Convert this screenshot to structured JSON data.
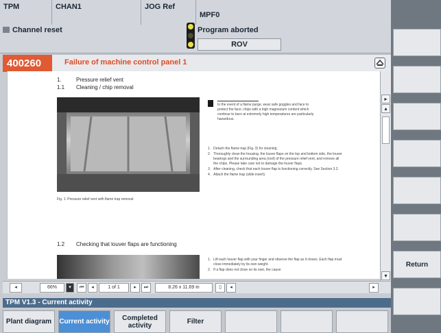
{
  "header": {
    "cell1": "TPM",
    "cell2": "CHAN1",
    "cell3": "JOG Ref",
    "cell4": "MPF0",
    "channel_status": "Channel reset",
    "program_status": "Program aborted",
    "rov": "ROV"
  },
  "alarm": {
    "code": "400260",
    "text": "Failure of machine control panel 1"
  },
  "document": {
    "section1_num": "1.",
    "section1_title": "Pressure relief vent",
    "section11_num": "1.1",
    "section11_title": "Cleaning / chip removal",
    "figure_caption": "Fig. 1: Pressure relief vent with flame trap removal",
    "note": "In the event of a flame purge, wear safe goggles and face to protect the face; chips with a high magnesium content which continue to burn at extremely high temperatures are particularly hazardous.",
    "steps": [
      {
        "num": "1.",
        "text": "Detach the flame trap (Fig. 3) for cleaning."
      },
      {
        "num": "2.",
        "text": "Thoroughly clean the housing, the louver flaps on the top and bottom side, the louver bearings and the surrounding area (roof) of the pressure relief vent, and remove all the chips. Please take care not to damage the louver flaps."
      },
      {
        "num": "3.",
        "text": "After cleaning, check that each louver flap is functioning correctly. See Section 3.2."
      },
      {
        "num": "4.",
        "text": "Attach the flame trap (slide insert)."
      }
    ],
    "section12_num": "1.2",
    "section12_title": "Checking that louver flaps are functioning",
    "steps2": [
      {
        "num": "1.",
        "text": "Lift each louver flap with your finger and observe the flap as it closes. Each flap must close immediately by its own weight."
      },
      {
        "num": "2.",
        "text": "If a flap does not close on its own, the cause"
      }
    ]
  },
  "pdf_toolbar": {
    "zoom": "66%",
    "page": "1 of 1",
    "page_size": "8.26 x 11.69 in"
  },
  "status": {
    "text": "TPM V1.3 - Current activity"
  },
  "softkeys_bottom": [
    {
      "label": "Plant diagram"
    },
    {
      "label": "Current activity"
    },
    {
      "label": "Completed activity"
    },
    {
      "label": "Filter"
    },
    {
      "label": ""
    },
    {
      "label": ""
    },
    {
      "label": ""
    }
  ],
  "softkeys_right": {
    "return_label": "Return"
  },
  "colors": {
    "alarm": "#e05a33",
    "status_bar": "#4c6c8c",
    "active_softkey": "#4b8fd6"
  }
}
